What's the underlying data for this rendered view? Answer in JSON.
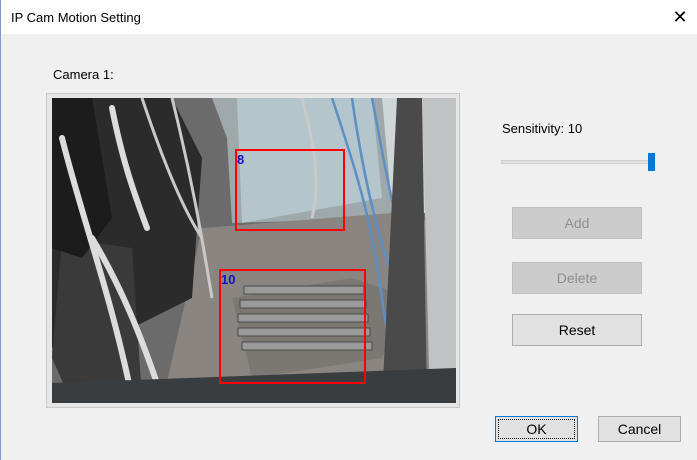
{
  "window": {
    "title": "IP Cam Motion Setting",
    "close_glyph": "✕"
  },
  "camera": {
    "label": "Camera 1:",
    "zones": [
      {
        "id": "8",
        "color": "#ff0000",
        "label_color": "#1010d0"
      },
      {
        "id": "10",
        "color": "#ff0000",
        "label_color": "#1010d0"
      }
    ]
  },
  "sensitivity": {
    "label": "Sensitivity: 10",
    "value": 10,
    "max": 10
  },
  "buttons": {
    "add": "Add",
    "delete": "Delete",
    "reset": "Reset",
    "ok": "OK",
    "cancel": "Cancel"
  }
}
